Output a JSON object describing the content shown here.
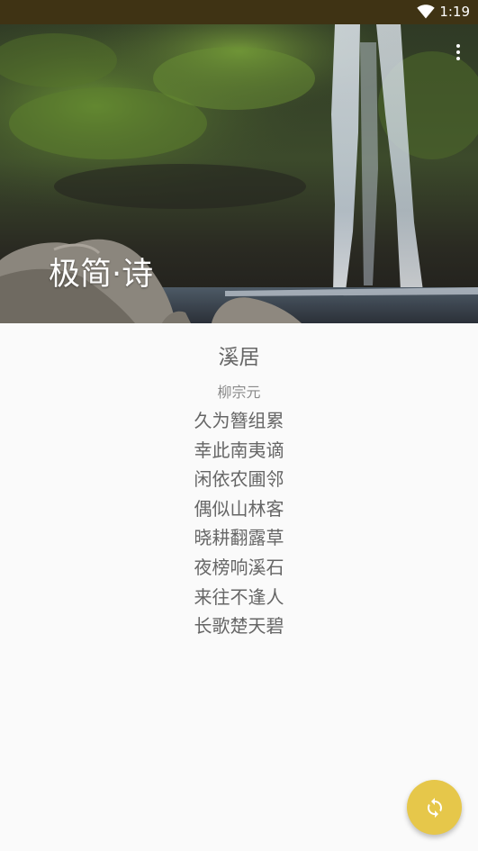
{
  "status_bar": {
    "time": "1:19",
    "wifi_icon": "wifi-icon"
  },
  "header": {
    "app_title": "极简·诗",
    "menu_icon": "more-vert-icon"
  },
  "poem": {
    "title": "溪居",
    "author": "柳宗元",
    "lines": [
      "久为簪组累",
      "幸此南夷谪",
      "闲依农圃邻",
      "偶似山林客",
      "晓耕翻露草",
      "夜榜响溪石",
      "来往不逢人",
      "长歌楚天碧"
    ]
  },
  "fab": {
    "icon": "refresh-icon",
    "color": "#e6c74a"
  },
  "colors": {
    "status_bar": "#3f3314",
    "background": "#fafafa",
    "text": "#666666"
  }
}
